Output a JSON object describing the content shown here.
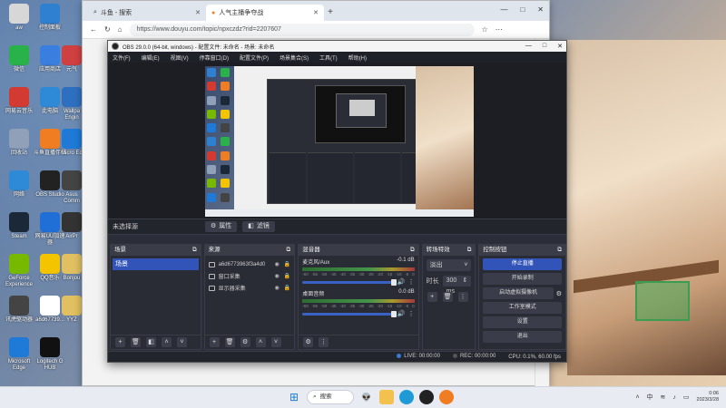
{
  "desktop": {
    "icons": [
      {
        "label": "aw",
        "icon": "folder-icon",
        "color": "#d7d7d7"
      },
      {
        "label": "控制面板",
        "icon": "control-panel-icon",
        "color": "#2f80d0"
      },
      {
        "label": "微信",
        "icon": "wechat-icon",
        "color": "#2ab24a"
      },
      {
        "label": "应用商店",
        "icon": "app-store-icon",
        "color": "#3a7ee0"
      },
      {
        "label": "网易云音乐",
        "icon": "netease-music-icon",
        "color": "#d33a31"
      },
      {
        "label": "此电脑",
        "icon": "this-pc-icon",
        "color": "#2e8ad6"
      },
      {
        "label": "回收站",
        "icon": "recycle-bin-icon",
        "color": "#8fa0b8"
      },
      {
        "label": "斗鱼直播伴侣",
        "icon": "douyu-icon",
        "color": "#f07d22"
      },
      {
        "label": "网络",
        "icon": "network-icon",
        "color": "#2e8ad6"
      },
      {
        "label": "OBS Studio",
        "icon": "obs-icon",
        "color": "#222222"
      },
      {
        "label": "Steam",
        "icon": "steam-icon",
        "color": "#1b2838"
      },
      {
        "label": "网易UU加速器",
        "icon": "uu-icon",
        "color": "#1f6fd6"
      },
      {
        "label": "GeForce Experience",
        "icon": "geforce-icon",
        "color": "#76b900"
      },
      {
        "label": "QQ音乐",
        "icon": "qqmusic-icon",
        "color": "#f5c400"
      },
      {
        "label": "讯虎驱动器",
        "icon": "driver-icon",
        "color": "#444444"
      },
      {
        "label": "a6d67739...",
        "icon": "file-icon",
        "color": "#ffffff"
      },
      {
        "label": "Microsoft Edge",
        "icon": "edge-icon",
        "color": "#1e7ad6"
      },
      {
        "label": "Logitech G HUB",
        "icon": "ghub-icon",
        "color": "#111111"
      }
    ],
    "column3": [
      {
        "label": "元气",
        "icon": "game-icon",
        "color": "#d04040"
      },
      {
        "label": "Wallpa Engin",
        "icon": "wallpaper-engine-icon",
        "color": "#2f6fbf"
      },
      {
        "label": "Micro Ed",
        "icon": "edge-icon",
        "color": "#1e7ad6"
      },
      {
        "label": "Asus Comm",
        "icon": "asus-icon",
        "color": "#444444"
      },
      {
        "label": "AirPr",
        "icon": "airpr-icon",
        "color": "#333333"
      },
      {
        "label": "Bonjou",
        "icon": "folder-icon",
        "color": "#e0c060"
      },
      {
        "label": "YYZ",
        "icon": "folder-icon",
        "color": "#e0c060"
      }
    ]
  },
  "browser": {
    "tabs": [
      {
        "label": "斗鱼 - 搜索",
        "icon": "search-icon"
      },
      {
        "label": "人气主播争夺战",
        "icon": "douyu-icon"
      }
    ],
    "new_tab": "+",
    "url": "https://www.douyu.com/topic/npxczdz?rid=2207607",
    "window_controls": [
      "—",
      "□",
      "✕"
    ]
  },
  "obs": {
    "title": "OBS 29.0.0 (64-bit, windows) - 配置文件: 未命名 - 场景: 未命名",
    "menu": [
      "文件(F)",
      "编辑(E)",
      "视图(V)",
      "停靠窗口(D)",
      "配置文件(P)",
      "场景集合(S)",
      "工具(T)",
      "帮助(H)"
    ],
    "source_bar": {
      "none": "未选择源",
      "properties": "属性",
      "filters": "滤镜"
    },
    "scenes": {
      "title": "场景",
      "items": [
        "场景"
      ]
    },
    "sources": {
      "title": "来源",
      "items": [
        "a6d6773963f3a4d0",
        "窗口采集",
        "显示器采集"
      ]
    },
    "mixer": {
      "title": "混音器",
      "channels": [
        {
          "name": "麦克风/Aux",
          "db": "-0.1 dB"
        },
        {
          "name": "桌面音频",
          "db": "0.0 dB"
        }
      ],
      "ticks": [
        "-60",
        "-55",
        "-50",
        "-45",
        "-40",
        "-35",
        "-30",
        "-25",
        "-20",
        "-15",
        "-10",
        "-5",
        "0"
      ]
    },
    "transitions": {
      "title": "转场特效",
      "selected": "淡出",
      "duration_label": "时长",
      "duration": "300 ms"
    },
    "controls": {
      "title": "控制按钮",
      "buttons": [
        "停止直播",
        "开始录制",
        "启动虚拟摄像机",
        "工作室模式",
        "设置",
        "退出"
      ]
    },
    "status": {
      "live": "LIVE: 00:00:00",
      "rec": "REC: 00:00:00",
      "cpu": "CPU: 0.1%, 60.00 fps"
    }
  },
  "taskbar": {
    "search": "搜索",
    "clock_time": "0:06",
    "clock_date": "2023/3/28",
    "lang": "中"
  }
}
